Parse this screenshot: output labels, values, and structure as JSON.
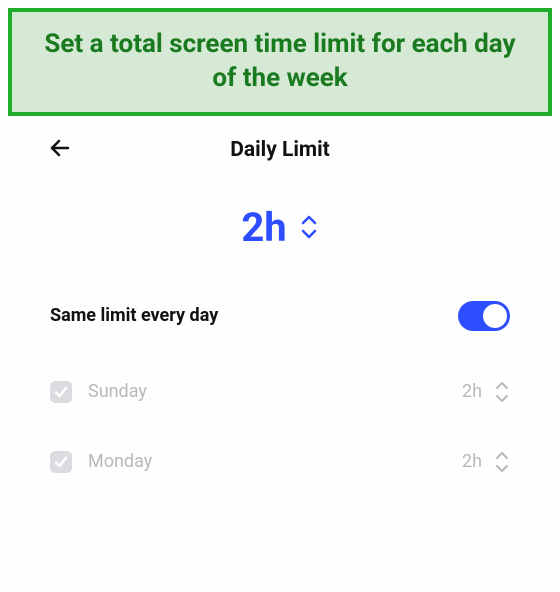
{
  "callout": {
    "text": "Set a total screen time limit for each day of the week"
  },
  "header": {
    "title": "Daily Limit"
  },
  "limit": {
    "value": "2h"
  },
  "same_limit": {
    "label": "Same limit every day",
    "enabled": true
  },
  "days": [
    {
      "name": "Sunday",
      "value": "2h",
      "checked": true
    },
    {
      "name": "Monday",
      "value": "2h",
      "checked": true
    }
  ],
  "colors": {
    "accent": "#2d4eff",
    "callout_border": "#1fad2a",
    "callout_bg": "#d6e9d5",
    "callout_text": "#1a7a1f"
  }
}
